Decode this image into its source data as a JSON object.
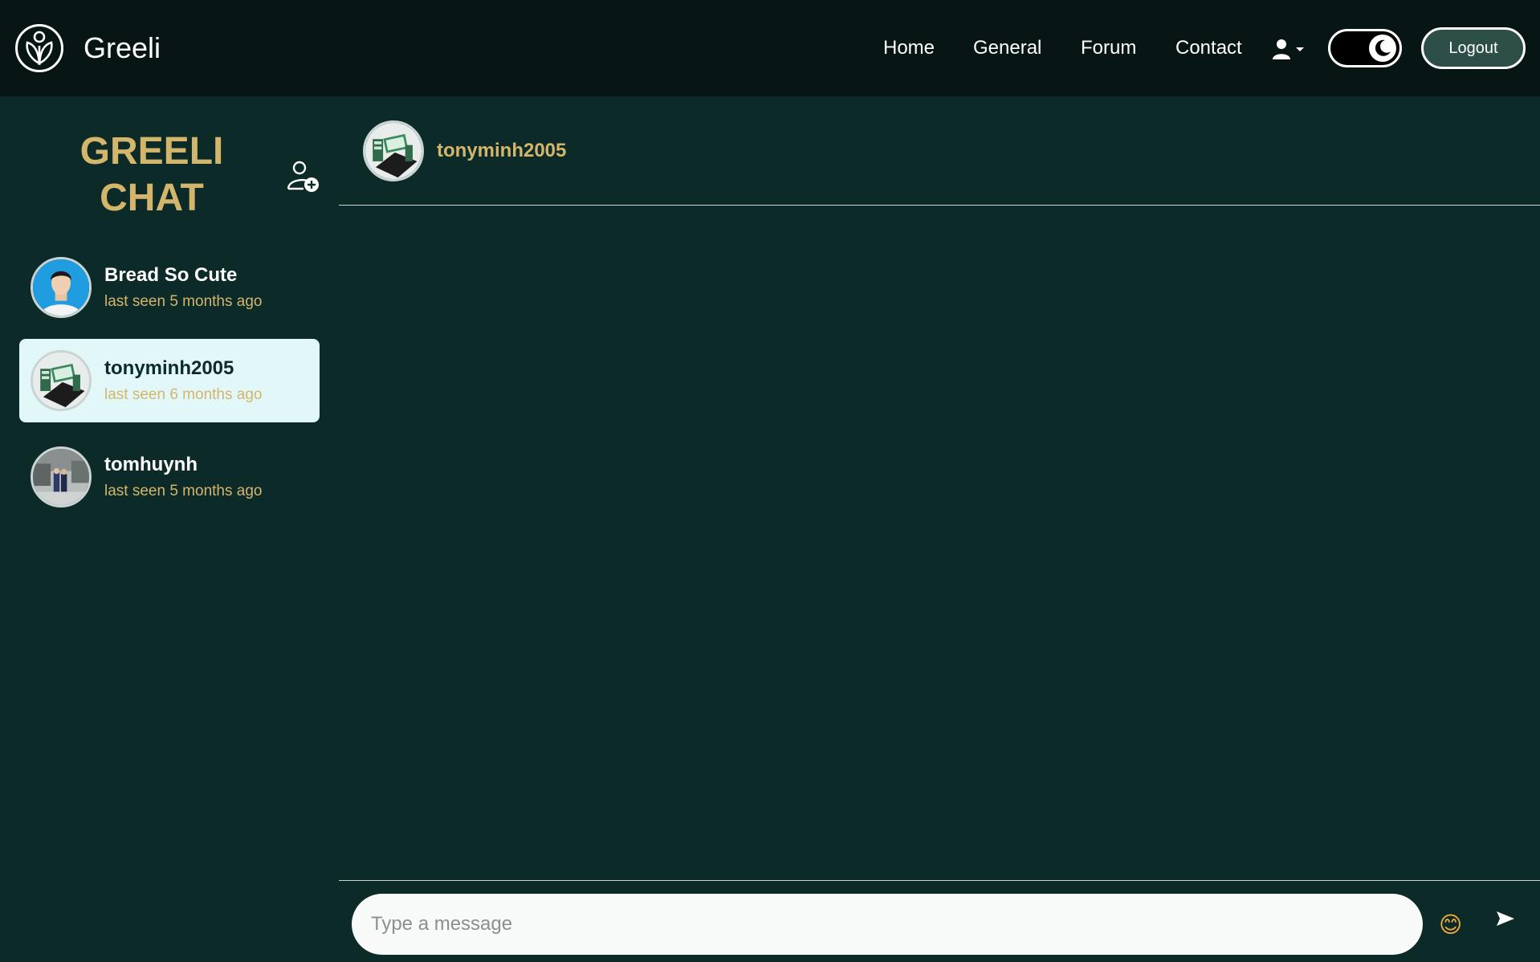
{
  "app": {
    "name": "Greeli"
  },
  "nav": {
    "home": "Home",
    "general": "General",
    "forum": "Forum",
    "contact": "Contact",
    "logout": "Logout"
  },
  "sidebar": {
    "title_line1": "GREELI",
    "title_line2": "CHAT",
    "contacts": [
      {
        "name": "Bread So Cute",
        "status": "last seen 5 months ago",
        "active": false
      },
      {
        "name": "tonyminh2005",
        "status": "last seen 6 months ago",
        "active": true
      },
      {
        "name": "tomhuynh",
        "status": "last seen 5 months ago",
        "active": false
      }
    ]
  },
  "chat": {
    "header_name": "tonyminh2005",
    "input_placeholder": "Type a message",
    "emoji": "😊"
  },
  "colors": {
    "background": "#0b2a28",
    "navbar": "#071614",
    "accent_gold": "#d4b56c",
    "active_item": "#e2f8f8",
    "logout_button": "#2e4f47"
  },
  "icons": [
    "greeli-logo-icon",
    "user-icon",
    "caret-down-icon",
    "moon-icon",
    "add-user-icon",
    "emoji-icon",
    "send-icon"
  ]
}
